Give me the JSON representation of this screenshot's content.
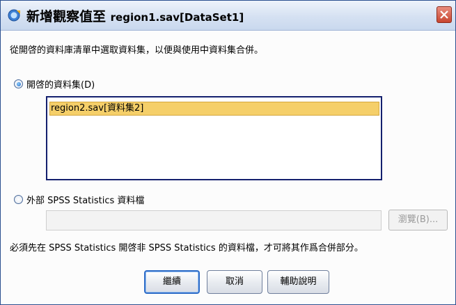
{
  "window": {
    "title_prefix": "新增觀察值至",
    "title_file": "region1.sav[DataSet1]"
  },
  "instruction": "從開啓的資料庫清單中選取資料集，以便與使用中資料集合併。",
  "option_open_dataset": {
    "label": "開啓的資料集(D)",
    "selected": true
  },
  "datasets": [
    "region2.sav[資料集2]"
  ],
  "option_external_file": {
    "label": "外部 SPSS Statistics 資料檔",
    "selected": false
  },
  "file_path": {
    "value": ""
  },
  "browse_label": "瀏覽(B)...",
  "note": "必須先在 SPSS Statistics 開啓非 SPSS Statistics 的資料檔，才可將其作爲合併部分。",
  "buttons": {
    "continue": "繼續",
    "cancel": "取消",
    "help": "輔助說明"
  }
}
